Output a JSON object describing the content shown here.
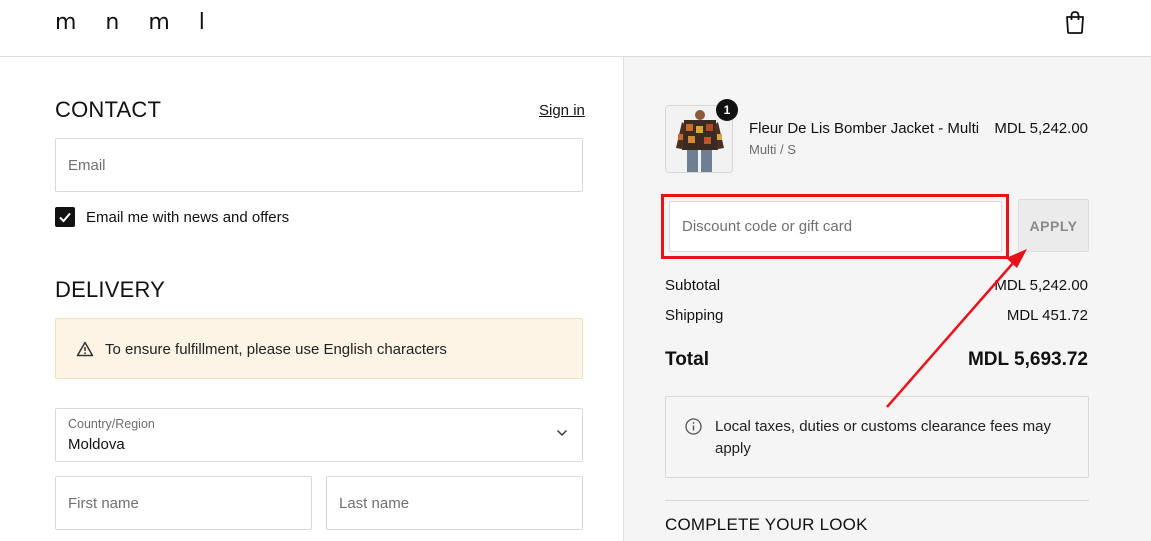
{
  "header": {
    "logo": "m n m l",
    "cart_icon": "shopping-bag-icon"
  },
  "contact": {
    "title": "CONTACT",
    "signin_label": "Sign in",
    "email_placeholder": "Email",
    "newsletter_label": "Email me with news and offers",
    "newsletter_checked": true
  },
  "delivery": {
    "title": "DELIVERY",
    "warning_icon": "warning-icon",
    "warning_text": "To ensure fulfillment, please use English characters",
    "country_label": "Country/Region",
    "country_value": "Moldova",
    "first_name_placeholder": "First name",
    "last_name_placeholder": "Last name"
  },
  "order": {
    "item": {
      "quantity": "1",
      "name": "Fleur De Lis Bomber Jacket - Multi",
      "variant": "Multi / S",
      "price": "MDL 5,242.00"
    },
    "discount_placeholder": "Discount code or gift card",
    "apply_label": "APPLY",
    "subtotal_label": "Subtotal",
    "subtotal_value": "MDL 5,242.00",
    "shipping_label": "Shipping",
    "shipping_value": "MDL 451.72",
    "total_label": "Total",
    "total_value": "MDL 5,693.72",
    "taxes_note": "Local taxes, duties or customs clearance fees may apply",
    "complete_look": "COMPLETE YOUR LOOK"
  },
  "colors": {
    "annotation_red": "#e8121b",
    "warning_bg": "#fdf4e6",
    "summary_bg": "#f5f5f5"
  }
}
